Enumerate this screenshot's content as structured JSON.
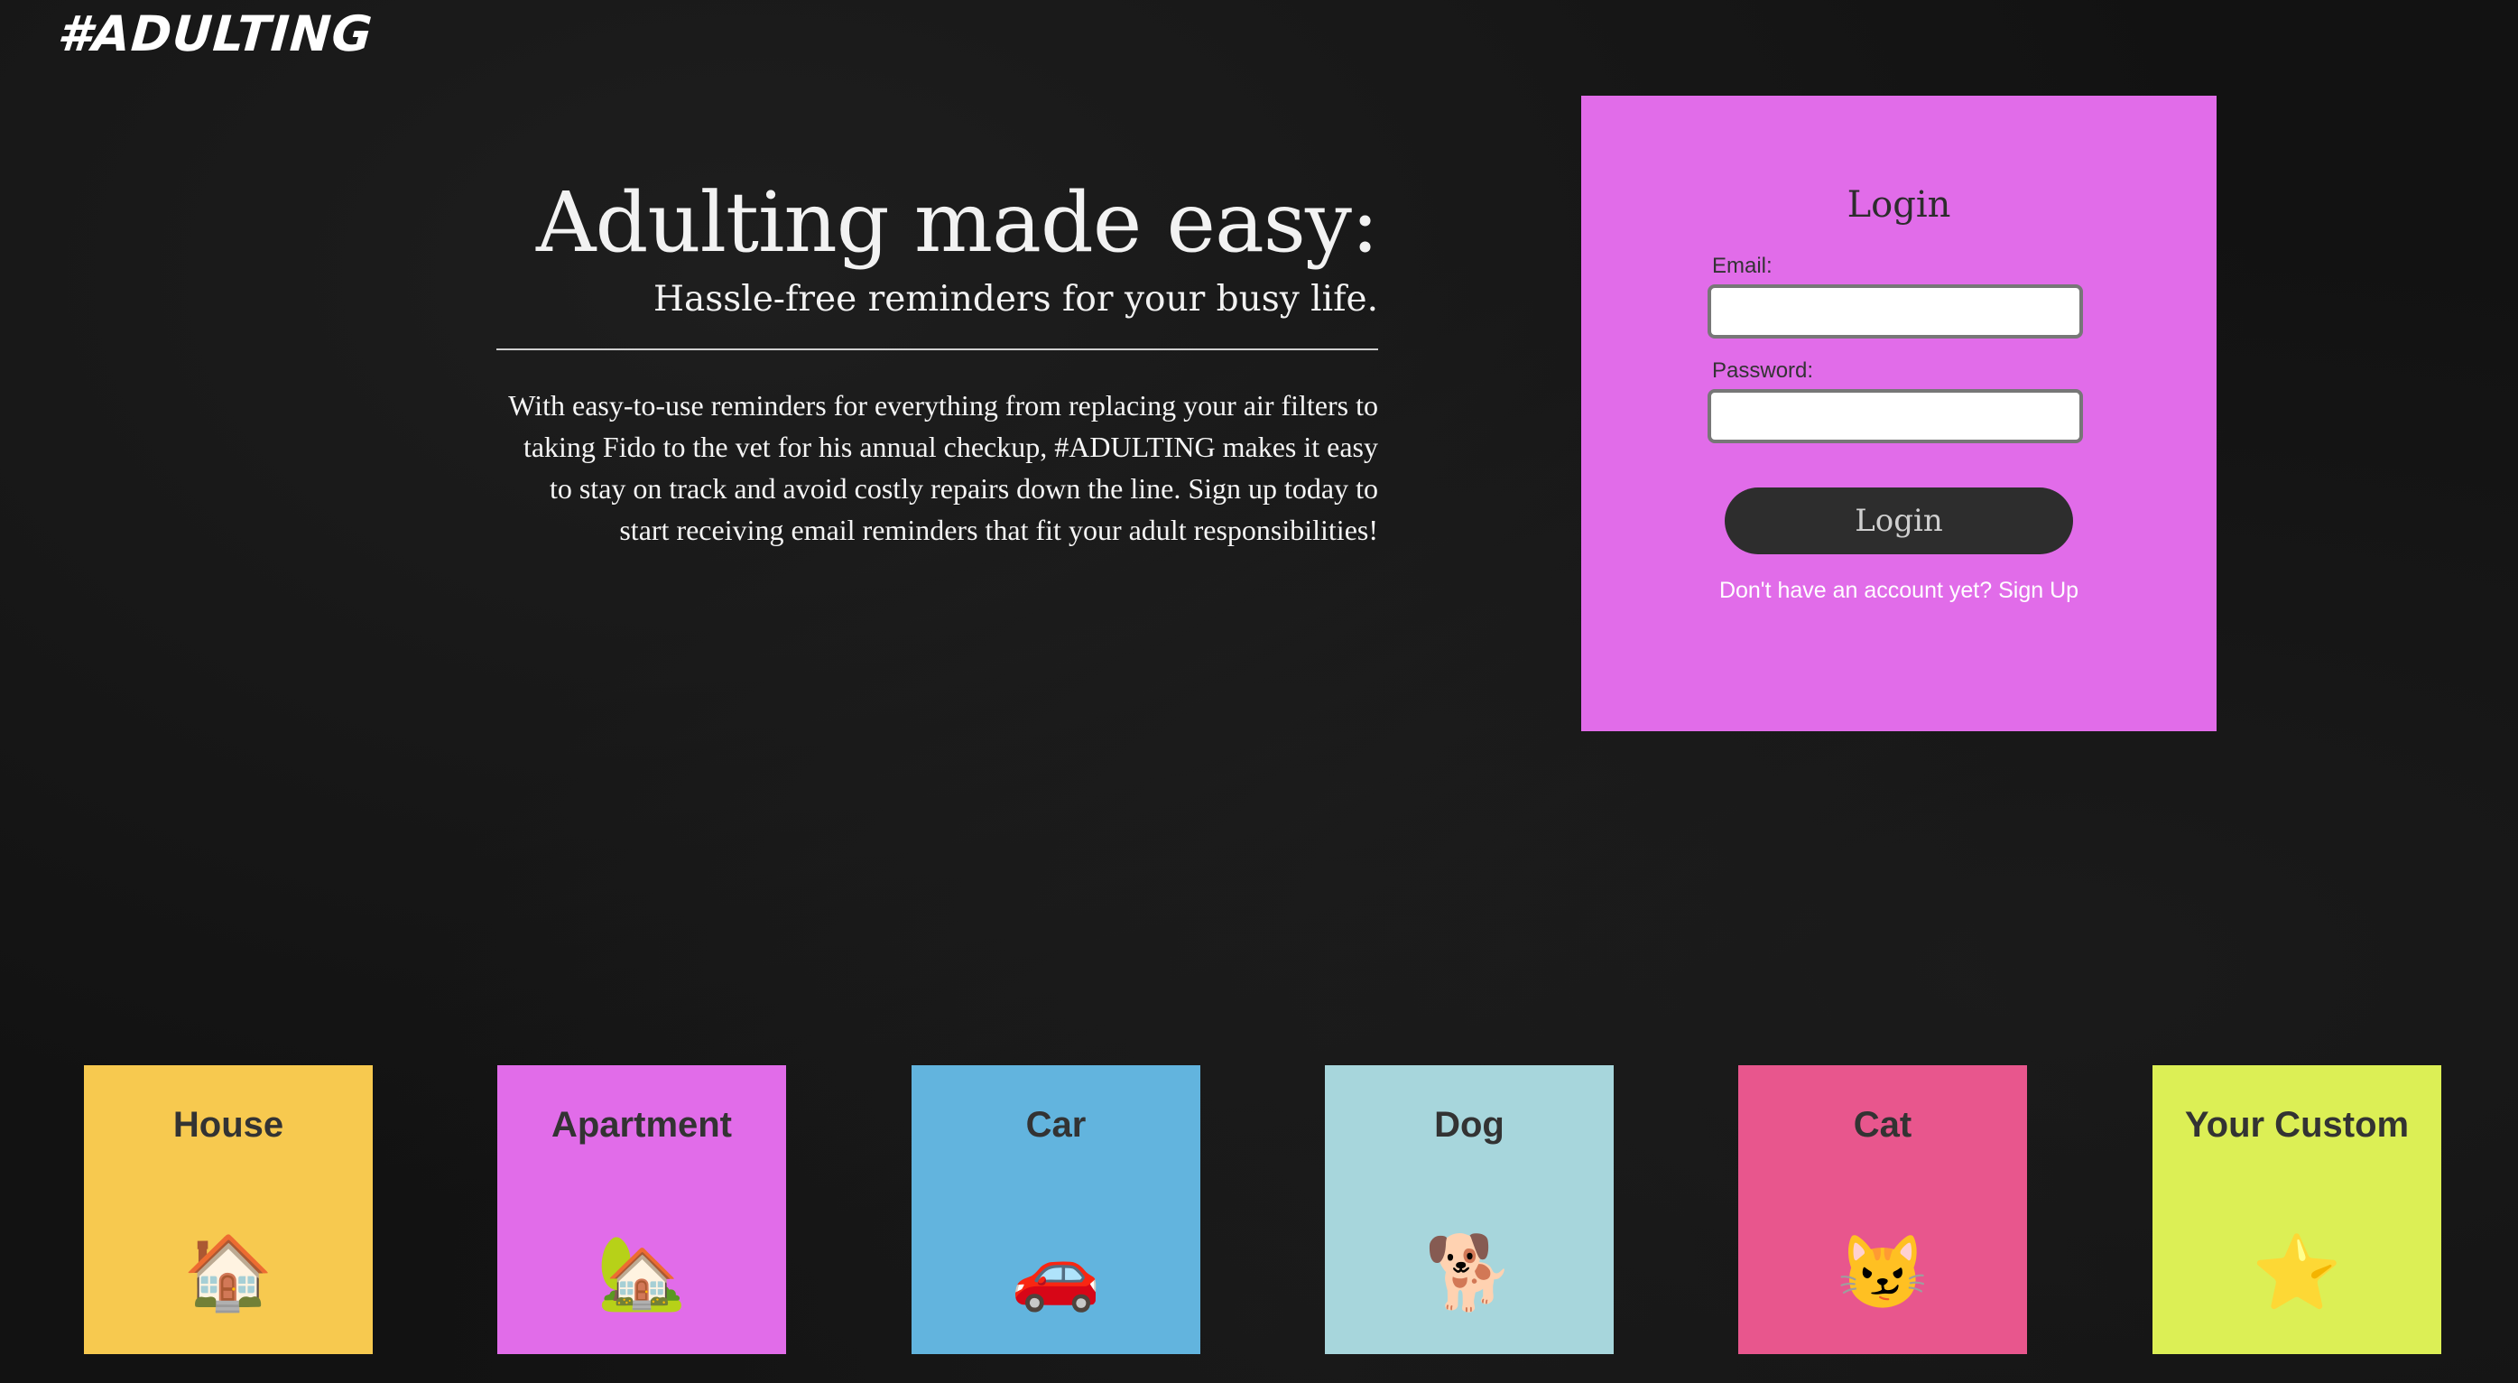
{
  "logo": {
    "text": "#ADULTING"
  },
  "hero": {
    "title": "Adulting made easy:",
    "subtitle": "Hassle-free reminders for your busy life.",
    "body": "With easy-to-use reminders for everything from replacing your air filters to taking Fido to the vet for his annual checkup, #ADULTING makes it easy to stay on track and avoid costly repairs down the line. Sign up today to start receiving email reminders that fit your adult responsibilities!"
  },
  "login": {
    "title": "Login",
    "email_label": "Email:",
    "email_value": "",
    "password_label": "Password:",
    "password_value": "",
    "button_label": "Login",
    "signup_prompt": "Don't have an account yet?",
    "signup_link": "Sign Up",
    "panel_color": "#e16ce9"
  },
  "categories": [
    {
      "label": "House",
      "emoji": "🏠",
      "color": "#f7c94f"
    },
    {
      "label": "Apartment",
      "emoji": "🏡",
      "color": "#e16ce9"
    },
    {
      "label": "Car",
      "emoji": "🚗",
      "color": "#62b4de"
    },
    {
      "label": "Dog",
      "emoji": "🐕",
      "color": "#a7d6dc"
    },
    {
      "label": "Cat",
      "emoji": "😼",
      "color": "#e8568d"
    },
    {
      "label": "Your Custom",
      "emoji": "⭐",
      "color": "#dcef55"
    }
  ]
}
